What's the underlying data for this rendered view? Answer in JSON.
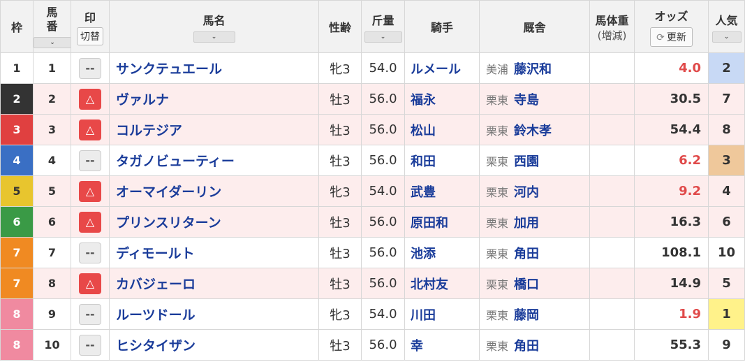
{
  "headers": {
    "waku": "枠",
    "umaban_1": "馬",
    "umaban_2": "番",
    "mark": "印",
    "mark_toggle": "切替",
    "name": "馬名",
    "sexage": "性齢",
    "weight": "斤量",
    "jockey": "騎手",
    "stable": "厩舎",
    "body_weight": "馬体重",
    "body_weight_sub": "(増減)",
    "odds": "オッズ",
    "refresh": "更新",
    "popularity": "人気",
    "sort_glyph": "⌄"
  },
  "marks": {
    "none": "--",
    "triangle": "△"
  },
  "colors": {
    "waku_1": "#ffffff",
    "waku_2": "#333333",
    "waku_3": "#e04040",
    "waku_4": "#3a6fc4",
    "waku_5": "#e8c52e",
    "waku_6": "#3a9a46",
    "waku_7": "#f08a22",
    "waku_8": "#f08aa0",
    "odds_hot": "#e04a4a",
    "odds_normal": "#333333",
    "pop_1": "#fff28a",
    "pop_2": "#c8d9f5",
    "pop_3": "#efc89b"
  },
  "rows": [
    {
      "waku": "1",
      "umaban": "1",
      "mark": "none",
      "name": "サンクテュエール",
      "sexage": "牝3",
      "weight": "54.0",
      "jockey": "ルメール",
      "region": "美浦",
      "trainer": "藤沢和",
      "odds": "4.0",
      "hot": true,
      "pop": "2"
    },
    {
      "waku": "2",
      "umaban": "2",
      "mark": "triangle",
      "name": "ヴァルナ",
      "sexage": "牡3",
      "weight": "56.0",
      "jockey": "福永",
      "region": "栗東",
      "trainer": "寺島",
      "odds": "30.5",
      "hot": false,
      "pop": "7"
    },
    {
      "waku": "3",
      "umaban": "3",
      "mark": "triangle",
      "name": "コルテジア",
      "sexage": "牡3",
      "weight": "56.0",
      "jockey": "松山",
      "region": "栗東",
      "trainer": "鈴木孝",
      "odds": "54.4",
      "hot": false,
      "pop": "8"
    },
    {
      "waku": "4",
      "umaban": "4",
      "mark": "none",
      "name": "タガノビューティー",
      "sexage": "牡3",
      "weight": "56.0",
      "jockey": "和田",
      "region": "栗東",
      "trainer": "西園",
      "odds": "6.2",
      "hot": true,
      "pop": "3"
    },
    {
      "waku": "5",
      "umaban": "5",
      "mark": "triangle",
      "name": "オーマイダーリン",
      "sexage": "牝3",
      "weight": "54.0",
      "jockey": "武豊",
      "region": "栗東",
      "trainer": "河内",
      "odds": "9.2",
      "hot": true,
      "pop": "4"
    },
    {
      "waku": "6",
      "umaban": "6",
      "mark": "triangle",
      "name": "プリンスリターン",
      "sexage": "牡3",
      "weight": "56.0",
      "jockey": "原田和",
      "region": "栗東",
      "trainer": "加用",
      "odds": "16.3",
      "hot": false,
      "pop": "6"
    },
    {
      "waku": "7",
      "umaban": "7",
      "mark": "none",
      "name": "ディモールト",
      "sexage": "牡3",
      "weight": "56.0",
      "jockey": "池添",
      "region": "栗東",
      "trainer": "角田",
      "odds": "108.1",
      "hot": false,
      "pop": "10"
    },
    {
      "waku": "7",
      "umaban": "8",
      "mark": "triangle",
      "name": "カバジェーロ",
      "sexage": "牡3",
      "weight": "56.0",
      "jockey": "北村友",
      "region": "栗東",
      "trainer": "橋口",
      "odds": "14.9",
      "hot": false,
      "pop": "5"
    },
    {
      "waku": "8",
      "umaban": "9",
      "mark": "none",
      "name": "ルーツドール",
      "sexage": "牝3",
      "weight": "54.0",
      "jockey": "川田",
      "region": "栗東",
      "trainer": "藤岡",
      "odds": "1.9",
      "hot": true,
      "pop": "1"
    },
    {
      "waku": "8",
      "umaban": "10",
      "mark": "none",
      "name": "ヒシタイザン",
      "sexage": "牡3",
      "weight": "56.0",
      "jockey": "幸",
      "region": "栗東",
      "trainer": "角田",
      "odds": "55.3",
      "hot": false,
      "pop": "9"
    }
  ]
}
